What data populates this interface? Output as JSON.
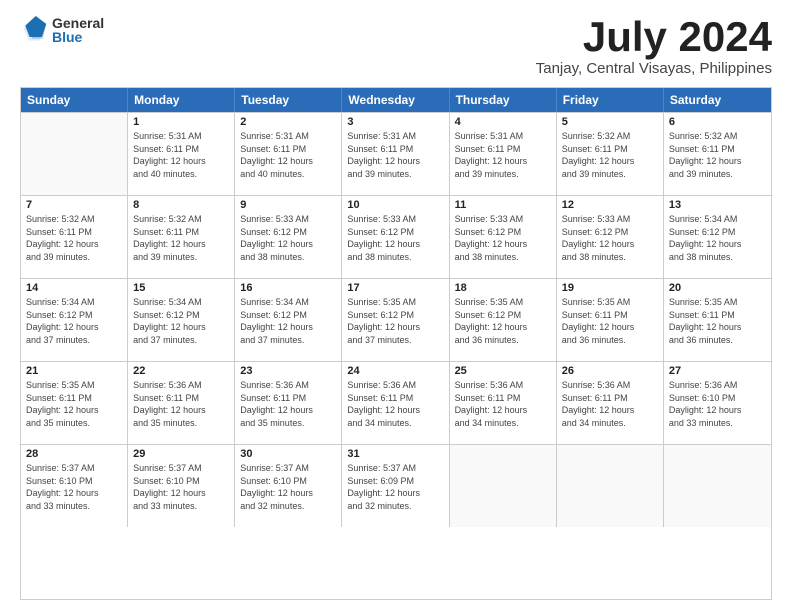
{
  "logo": {
    "general": "General",
    "blue": "Blue"
  },
  "title": "July 2024",
  "location": "Tanjay, Central Visayas, Philippines",
  "days_of_week": [
    "Sunday",
    "Monday",
    "Tuesday",
    "Wednesday",
    "Thursday",
    "Friday",
    "Saturday"
  ],
  "weeks": [
    [
      {
        "day": "",
        "empty": true
      },
      {
        "day": "1",
        "sunrise": "5:31 AM",
        "sunset": "6:11 PM",
        "daylight": "12 hours and 40 minutes."
      },
      {
        "day": "2",
        "sunrise": "5:31 AM",
        "sunset": "6:11 PM",
        "daylight": "12 hours and 40 minutes."
      },
      {
        "day": "3",
        "sunrise": "5:31 AM",
        "sunset": "6:11 PM",
        "daylight": "12 hours and 39 minutes."
      },
      {
        "day": "4",
        "sunrise": "5:31 AM",
        "sunset": "6:11 PM",
        "daylight": "12 hours and 39 minutes."
      },
      {
        "day": "5",
        "sunrise": "5:32 AM",
        "sunset": "6:11 PM",
        "daylight": "12 hours and 39 minutes."
      },
      {
        "day": "6",
        "sunrise": "5:32 AM",
        "sunset": "6:11 PM",
        "daylight": "12 hours and 39 minutes."
      }
    ],
    [
      {
        "day": "7",
        "sunrise": "5:32 AM",
        "sunset": "6:11 PM",
        "daylight": "12 hours and 39 minutes."
      },
      {
        "day": "8",
        "sunrise": "5:32 AM",
        "sunset": "6:11 PM",
        "daylight": "12 hours and 39 minutes."
      },
      {
        "day": "9",
        "sunrise": "5:33 AM",
        "sunset": "6:12 PM",
        "daylight": "12 hours and 38 minutes."
      },
      {
        "day": "10",
        "sunrise": "5:33 AM",
        "sunset": "6:12 PM",
        "daylight": "12 hours and 38 minutes."
      },
      {
        "day": "11",
        "sunrise": "5:33 AM",
        "sunset": "6:12 PM",
        "daylight": "12 hours and 38 minutes."
      },
      {
        "day": "12",
        "sunrise": "5:33 AM",
        "sunset": "6:12 PM",
        "daylight": "12 hours and 38 minutes."
      },
      {
        "day": "13",
        "sunrise": "5:34 AM",
        "sunset": "6:12 PM",
        "daylight": "12 hours and 38 minutes."
      }
    ],
    [
      {
        "day": "14",
        "sunrise": "5:34 AM",
        "sunset": "6:12 PM",
        "daylight": "12 hours and 37 minutes."
      },
      {
        "day": "15",
        "sunrise": "5:34 AM",
        "sunset": "6:12 PM",
        "daylight": "12 hours and 37 minutes."
      },
      {
        "day": "16",
        "sunrise": "5:34 AM",
        "sunset": "6:12 PM",
        "daylight": "12 hours and 37 minutes."
      },
      {
        "day": "17",
        "sunrise": "5:35 AM",
        "sunset": "6:12 PM",
        "daylight": "12 hours and 37 minutes."
      },
      {
        "day": "18",
        "sunrise": "5:35 AM",
        "sunset": "6:12 PM",
        "daylight": "12 hours and 36 minutes."
      },
      {
        "day": "19",
        "sunrise": "5:35 AM",
        "sunset": "6:11 PM",
        "daylight": "12 hours and 36 minutes."
      },
      {
        "day": "20",
        "sunrise": "5:35 AM",
        "sunset": "6:11 PM",
        "daylight": "12 hours and 36 minutes."
      }
    ],
    [
      {
        "day": "21",
        "sunrise": "5:35 AM",
        "sunset": "6:11 PM",
        "daylight": "12 hours and 35 minutes."
      },
      {
        "day": "22",
        "sunrise": "5:36 AM",
        "sunset": "6:11 PM",
        "daylight": "12 hours and 35 minutes."
      },
      {
        "day": "23",
        "sunrise": "5:36 AM",
        "sunset": "6:11 PM",
        "daylight": "12 hours and 35 minutes."
      },
      {
        "day": "24",
        "sunrise": "5:36 AM",
        "sunset": "6:11 PM",
        "daylight": "12 hours and 34 minutes."
      },
      {
        "day": "25",
        "sunrise": "5:36 AM",
        "sunset": "6:11 PM",
        "daylight": "12 hours and 34 minutes."
      },
      {
        "day": "26",
        "sunrise": "5:36 AM",
        "sunset": "6:11 PM",
        "daylight": "12 hours and 34 minutes."
      },
      {
        "day": "27",
        "sunrise": "5:36 AM",
        "sunset": "6:10 PM",
        "daylight": "12 hours and 33 minutes."
      }
    ],
    [
      {
        "day": "28",
        "sunrise": "5:37 AM",
        "sunset": "6:10 PM",
        "daylight": "12 hours and 33 minutes."
      },
      {
        "day": "29",
        "sunrise": "5:37 AM",
        "sunset": "6:10 PM",
        "daylight": "12 hours and 33 minutes."
      },
      {
        "day": "30",
        "sunrise": "5:37 AM",
        "sunset": "6:10 PM",
        "daylight": "12 hours and 32 minutes."
      },
      {
        "day": "31",
        "sunrise": "5:37 AM",
        "sunset": "6:09 PM",
        "daylight": "12 hours and 32 minutes."
      },
      {
        "day": "",
        "empty": true
      },
      {
        "day": "",
        "empty": true
      },
      {
        "day": "",
        "empty": true
      }
    ]
  ]
}
